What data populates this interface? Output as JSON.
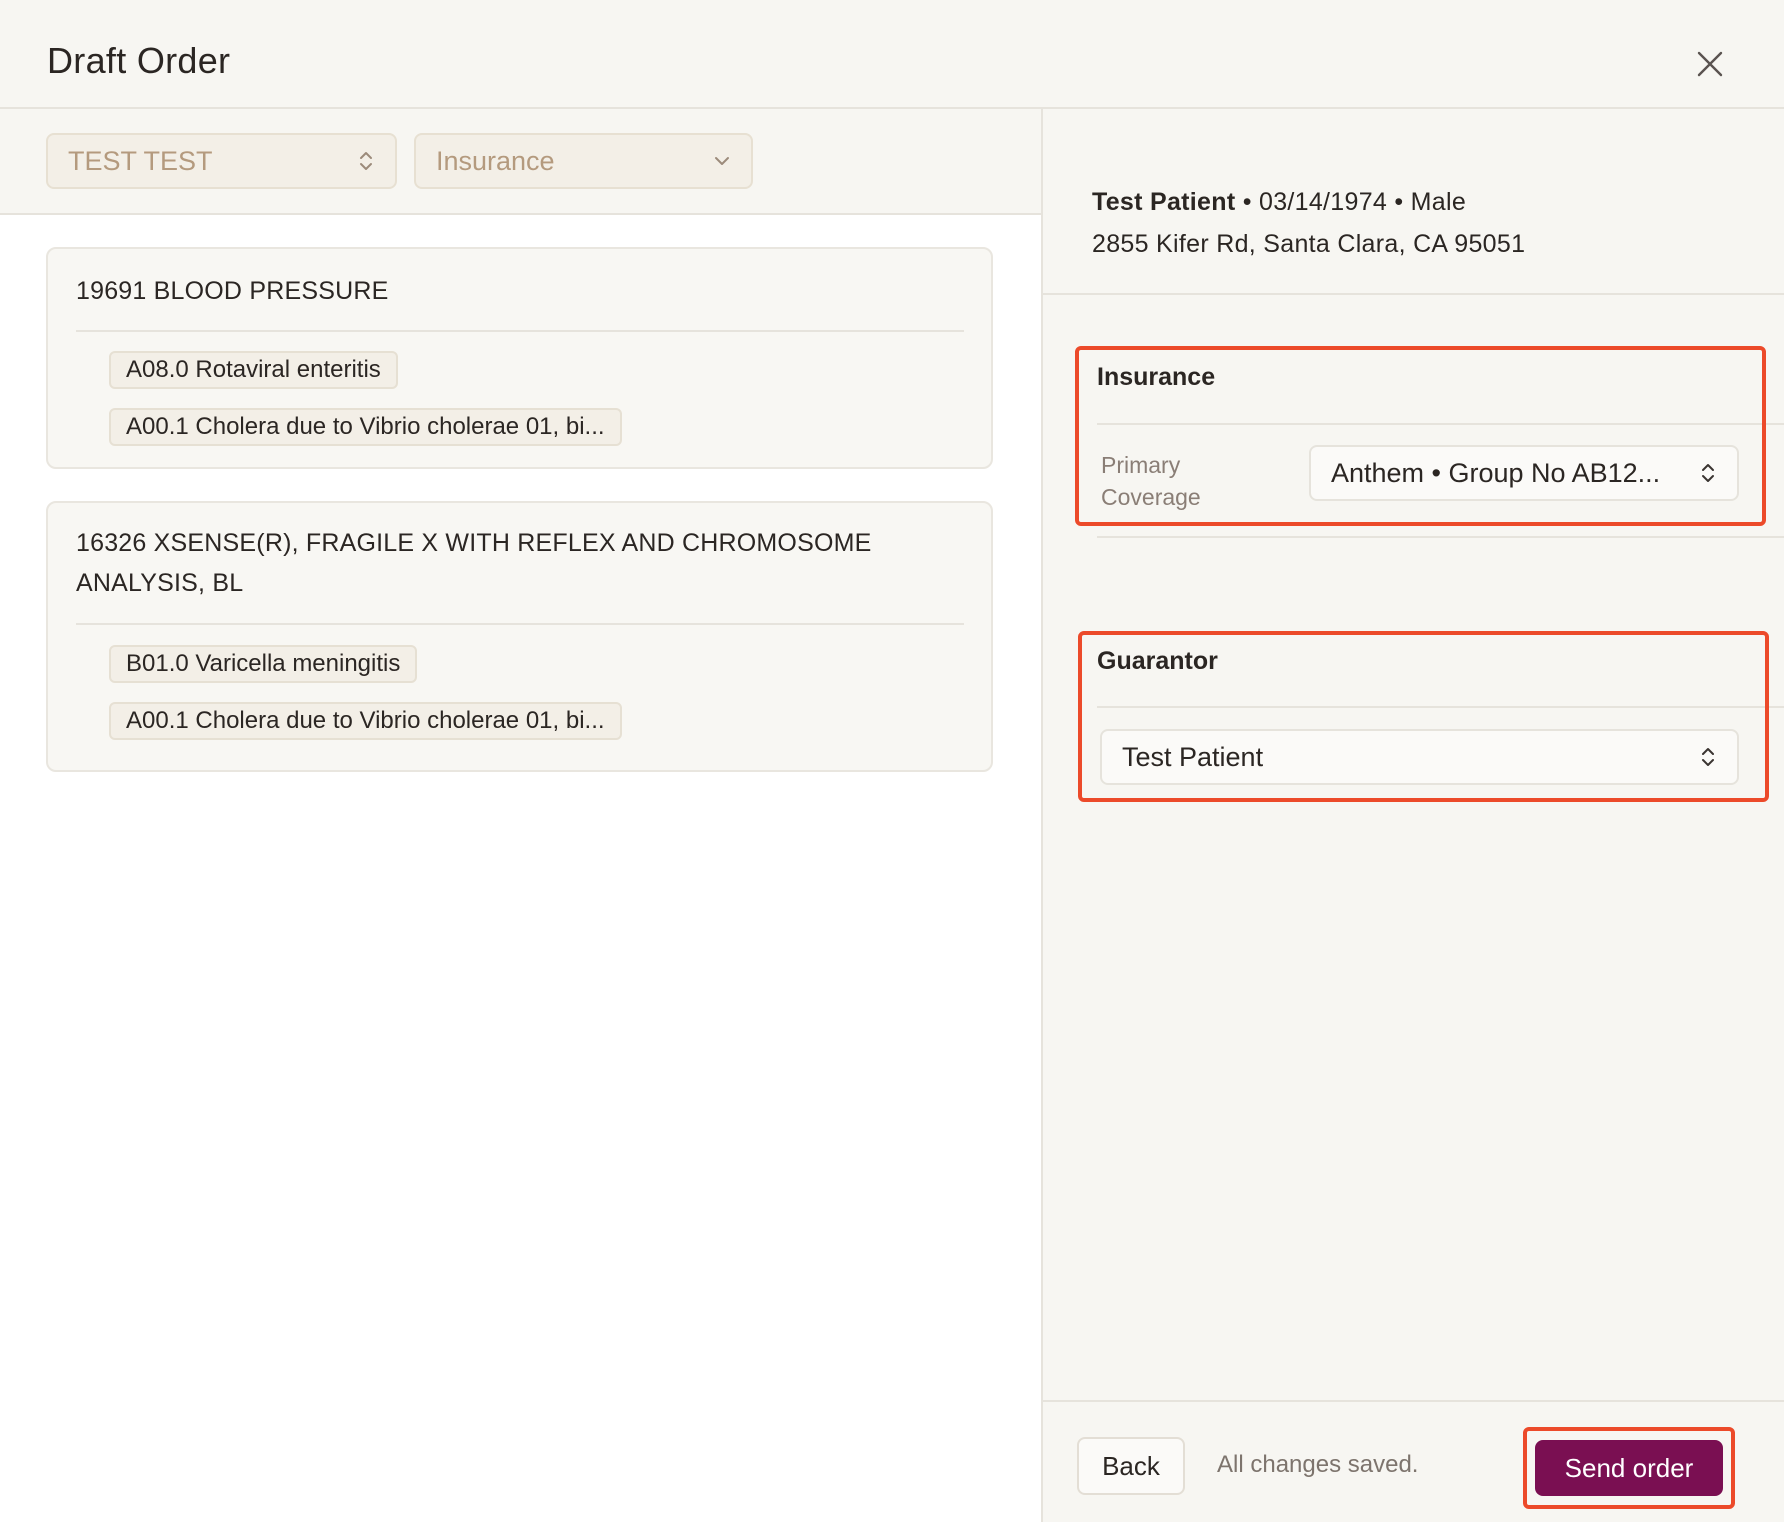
{
  "header": {
    "title": "Draft Order",
    "close_icon": "close-icon"
  },
  "filters": {
    "patient_select": "TEST TEST",
    "billing_select": "Insurance"
  },
  "orders": [
    {
      "title": "19691 BLOOD PRESSURE",
      "diagnoses": [
        "A08.0 Rotaviral enteritis",
        "A00.1 Cholera due to Vibrio cholerae 01, bi..."
      ]
    },
    {
      "title": "16326 XSENSE(R), FRAGILE X WITH REFLEX AND CHROMOSOME ANALYSIS, BL",
      "diagnoses": [
        "B01.0 Varicella meningitis",
        "A00.1 Cholera due to Vibrio cholerae 01, bi..."
      ]
    }
  ],
  "patient": {
    "name": "Test Patient",
    "details": " • 03/14/1974 • Male",
    "address": "2855 Kifer Rd, Santa Clara, CA 95051"
  },
  "insurance": {
    "title": "Insurance",
    "primary_label": "Primary Coverage",
    "primary_value": "Anthem • Group No AB12..."
  },
  "guarantor": {
    "title": "Guarantor",
    "value": "Test Patient"
  },
  "footer": {
    "back_label": "Back",
    "status": "All changes saved.",
    "send_label": "Send order"
  },
  "colors": {
    "accent": "#7a0f52",
    "highlight": "#ec4a2a",
    "background": "#f7f6f2"
  }
}
